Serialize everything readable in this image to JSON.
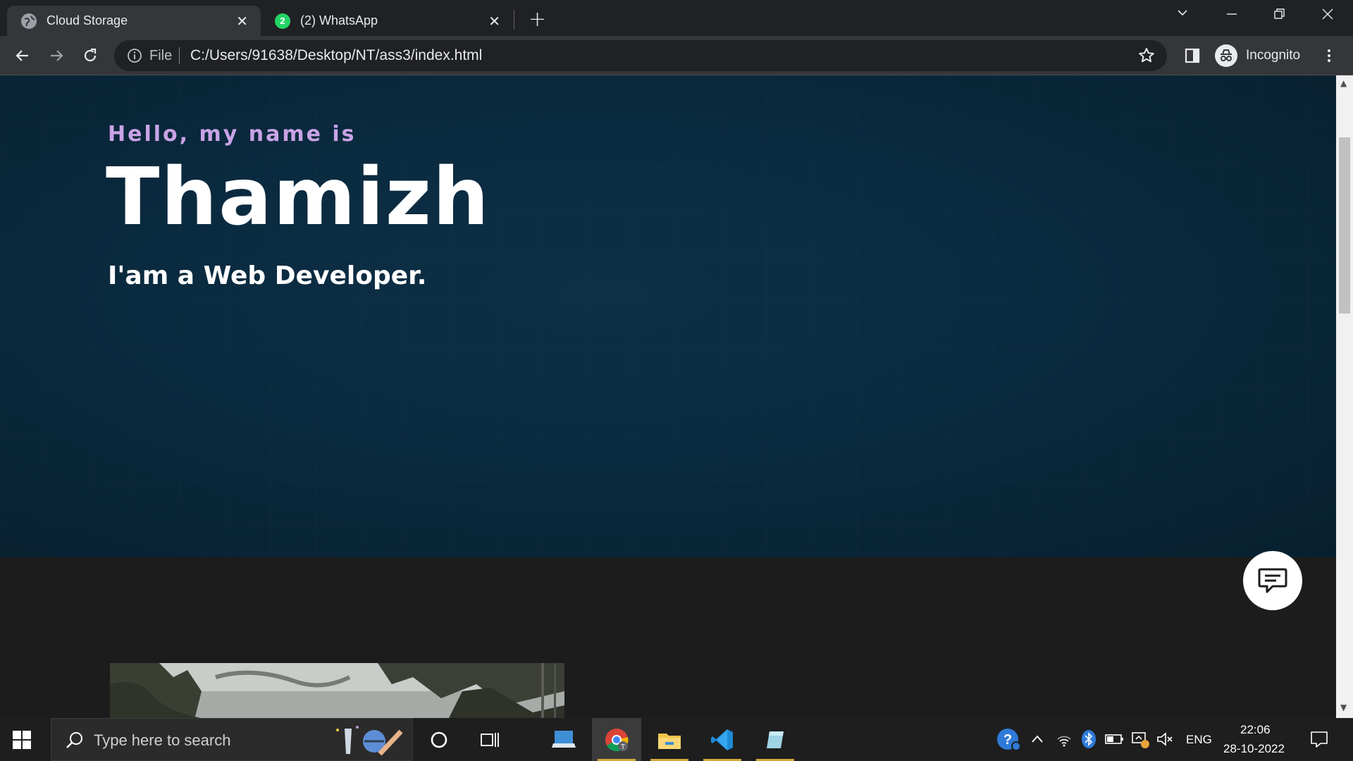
{
  "browser": {
    "tabs": [
      {
        "title": "Cloud Storage",
        "active": true
      },
      {
        "title": "(2) WhatsApp",
        "active": false,
        "badge": "2"
      }
    ],
    "new_tab_label": "+",
    "url_scheme_label": "File",
    "url": "C:/Users/91638/Desktop/NT/ass3/index.html",
    "profile_label": "Incognito",
    "colors": {
      "tabbar": "#202124",
      "toolbar": "#35363a",
      "whatsapp": "#25d366"
    }
  },
  "page": {
    "greeting": "Hello, my name is",
    "name": "Thamizh",
    "role": "I'am a Web Developer.",
    "colors": {
      "greeting": "#c9a3e6",
      "hero_bg": "#0a2a3f",
      "section_bg": "#1c1c1c"
    }
  },
  "taskbar": {
    "search_placeholder": "Type here to search",
    "language": "ENG",
    "time": "22:06",
    "date": "28-10-2022"
  }
}
